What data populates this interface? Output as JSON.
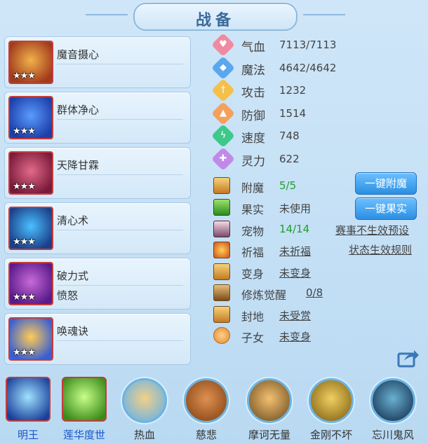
{
  "title": "战备",
  "skills": [
    {
      "name": "魔音摄心",
      "sub": "",
      "stars": "★★★",
      "colors": [
        "#f0b24a",
        "#a23a1d"
      ]
    },
    {
      "name": "群体净心",
      "sub": "",
      "stars": "★★★",
      "colors": [
        "#5a9cff",
        "#1d3ea8"
      ]
    },
    {
      "name": "天降甘霖",
      "sub": "",
      "stars": "★★★",
      "colors": [
        "#e26a8a",
        "#7a1a3a"
      ]
    },
    {
      "name": "清心术",
      "sub": "",
      "stars": "★★★",
      "colors": [
        "#4ac0ff",
        "#1b3f8a"
      ]
    },
    {
      "name": "破力式",
      "sub": "愤怒",
      "stars": "★★★",
      "colors": [
        "#c86ad8",
        "#5a1a8a"
      ]
    },
    {
      "name": "唤魂诀",
      "sub": "",
      "stars": "★★★",
      "colors": [
        "#ffcc55",
        "#3b5fd1"
      ]
    }
  ],
  "stats": [
    {
      "label": "气血",
      "value": "7113/7113",
      "color": "#f08aa0",
      "icon": "heart-icon",
      "glyph": "♥"
    },
    {
      "label": "魔法",
      "value": "4642/4642",
      "color": "#5aa7f0",
      "icon": "mana-icon",
      "glyph": "◆"
    },
    {
      "label": "攻击",
      "value": "1232",
      "color": "#f5c04a",
      "icon": "sword-icon",
      "glyph": "†"
    },
    {
      "label": "防御",
      "value": "1514",
      "color": "#f4a05a",
      "icon": "shield-icon",
      "glyph": "▲"
    },
    {
      "label": "速度",
      "value": "748",
      "color": "#3cc98a",
      "icon": "speed-icon",
      "glyph": "ϟ"
    },
    {
      "label": "灵力",
      "value": "622",
      "color": "#c08ae8",
      "icon": "spirit-icon",
      "glyph": "✚"
    }
  ],
  "features": {
    "enchant": {
      "label": "附魔",
      "value": "5/5",
      "icon": "enchant-icon"
    },
    "fruit": {
      "label": "果实",
      "value": "未使用",
      "icon": "fruit-icon"
    },
    "pet": {
      "label": "宠物",
      "value": "14/14",
      "icon": "pet-icon"
    },
    "bless": {
      "label": "祈福",
      "value": "未祈福",
      "icon": "bless-icon"
    },
    "transform": {
      "label": "变身",
      "value": "未变身",
      "icon": "transform-icon"
    },
    "awaken": {
      "label": "修炼觉醒",
      "value": "0/8",
      "icon": "awaken-icon"
    },
    "fief": {
      "label": "封地",
      "value": "未受赏",
      "icon": "fief-icon"
    },
    "children": {
      "label": "子女",
      "value": "未变身",
      "icon": "children-icon"
    }
  },
  "buttons": {
    "one_click_enchant": "一键附魔",
    "one_click_fruit": "一键果实"
  },
  "links": {
    "event_preset": "赛事不生效预设",
    "status_rules": "状态生效规则"
  },
  "bottom": [
    {
      "label": "明王",
      "type": "square",
      "labelColor": "#1a57c8",
      "colors": [
        "#9fe2ff",
        "#1a3f9a"
      ]
    },
    {
      "label": "莲华度世",
      "type": "square",
      "labelColor": "#1a57c8",
      "colors": [
        "#c8ff8a",
        "#3a8a1a"
      ]
    },
    {
      "label": "热血",
      "type": "round",
      "labelColor": "#333333",
      "colors": [
        "#f2d08a",
        "#6fb3e0"
      ]
    },
    {
      "label": "慈悲",
      "type": "round",
      "labelColor": "#333333",
      "colors": [
        "#e09050",
        "#8a4a1a"
      ]
    },
    {
      "label": "摩诃无量",
      "type": "round",
      "labelColor": "#333333",
      "colors": [
        "#f4c070",
        "#7a5a2a"
      ]
    },
    {
      "label": "金刚不坏",
      "type": "round",
      "labelColor": "#333333",
      "colors": [
        "#f0d060",
        "#8a6a1a"
      ]
    },
    {
      "label": "忘川鬼风",
      "type": "round",
      "labelColor": "#333333",
      "colors": [
        "#6ab0d0",
        "#1a3a5a"
      ]
    }
  ]
}
